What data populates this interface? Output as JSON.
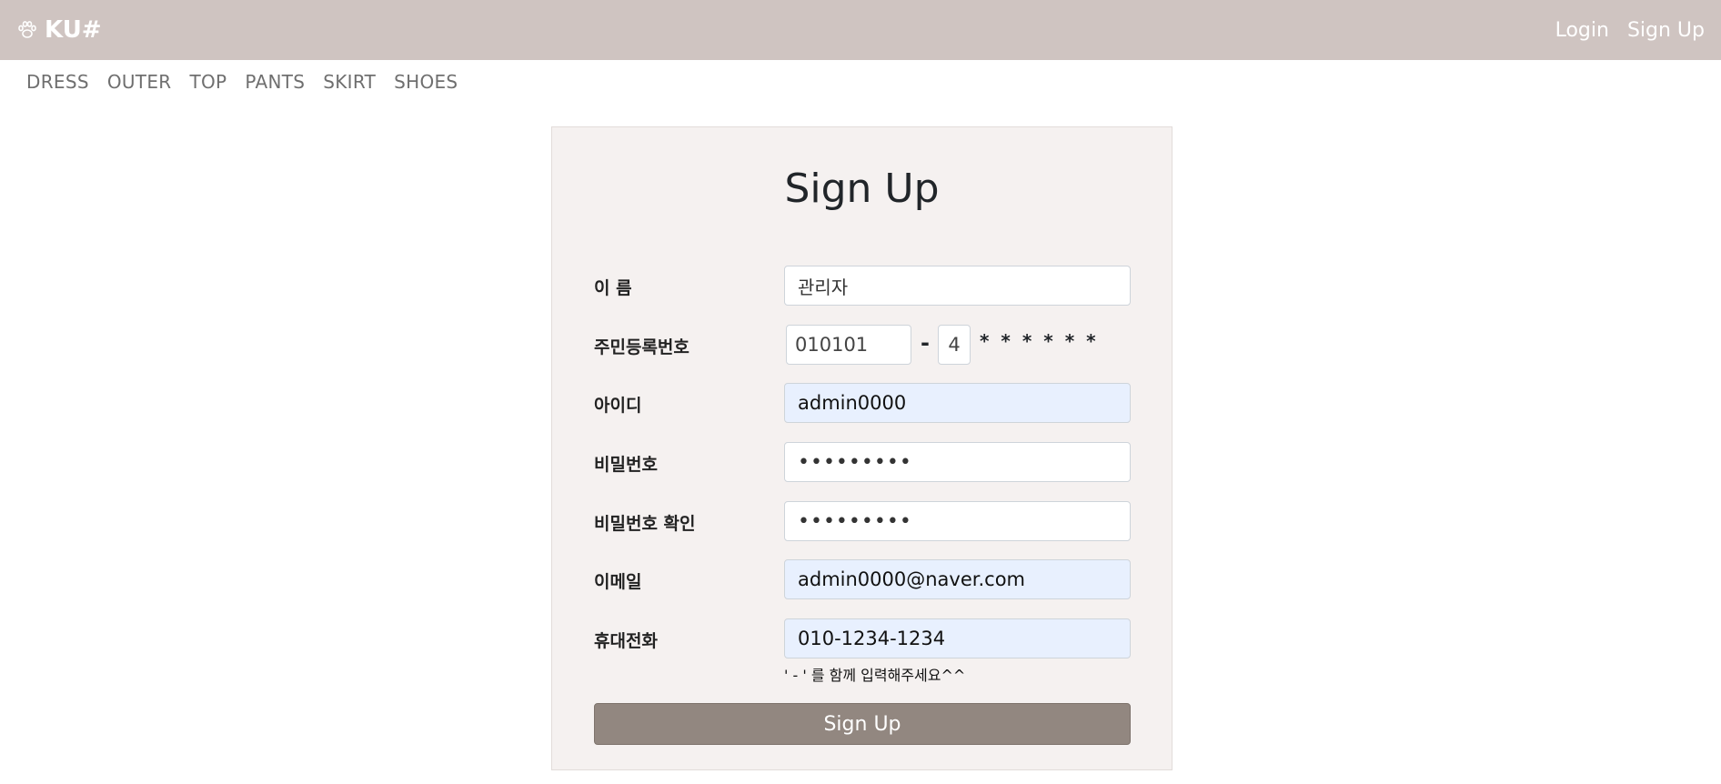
{
  "brand": {
    "name": "KU#",
    "icon": "paw-icon"
  },
  "nav": {
    "login": "Login",
    "signup": "Sign Up"
  },
  "categories": [
    "DRESS",
    "OUTER",
    "TOP",
    "PANTS",
    "SKIRT",
    "SHOES"
  ],
  "form": {
    "title": "Sign Up",
    "name": {
      "label": "이 름",
      "value": "관리자"
    },
    "ssn": {
      "label": "주민등록번호",
      "front": "010101",
      "dash": "-",
      "back_first": "4",
      "mask": "* * * * * *"
    },
    "userid": {
      "label": "아이디",
      "value": "admin0000"
    },
    "password": {
      "label": "비밀번호",
      "value": "•••••••••"
    },
    "password_confirm": {
      "label": "비밀번호 확인",
      "value": "•••••••••"
    },
    "email": {
      "label": "이메일",
      "value": "admin0000@naver.com"
    },
    "phone": {
      "label": "휴대전화",
      "value": "010-1234-1234",
      "hint": "' - ' 를 함께 입력해주세요^^"
    },
    "submit_label": "Sign Up"
  },
  "colors": {
    "navbar": "#cfc4c1",
    "card": "#f5f1f0",
    "button": "#928780",
    "autofill": "#e8f0fe"
  }
}
